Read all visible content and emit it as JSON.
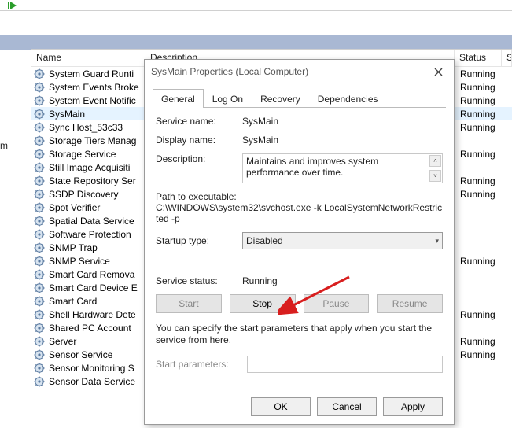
{
  "toolbar": {
    "play_icon": "play-icon"
  },
  "left_marker": "m",
  "columns": {
    "name": "Name",
    "desc": "Description",
    "status": "Status",
    "stype": "S"
  },
  "services": [
    {
      "name": "System Guard Runti",
      "status": "Running",
      "selected": false
    },
    {
      "name": "System Events Broke",
      "status": "Running",
      "selected": false
    },
    {
      "name": "System Event Notific",
      "status": "Running",
      "selected": false
    },
    {
      "name": "SysMain",
      "status": "Running",
      "selected": true
    },
    {
      "name": "Sync Host_53c33",
      "status": "Running",
      "selected": false
    },
    {
      "name": "Storage Tiers Manag",
      "status": "",
      "selected": false
    },
    {
      "name": "Storage Service",
      "status": "Running",
      "selected": false
    },
    {
      "name": "Still Image Acquisiti",
      "status": "",
      "selected": false
    },
    {
      "name": "State Repository Ser",
      "status": "Running",
      "selected": false
    },
    {
      "name": "SSDP Discovery",
      "status": "Running",
      "selected": false
    },
    {
      "name": "Spot Verifier",
      "status": "",
      "selected": false
    },
    {
      "name": "Spatial Data Service",
      "status": "",
      "selected": false
    },
    {
      "name": "Software Protection",
      "status": "",
      "selected": false
    },
    {
      "name": "SNMP Trap",
      "status": "",
      "selected": false
    },
    {
      "name": "SNMP Service",
      "status": "Running",
      "selected": false
    },
    {
      "name": "Smart Card Remova",
      "status": "",
      "selected": false
    },
    {
      "name": "Smart Card Device E",
      "status": "",
      "selected": false
    },
    {
      "name": "Smart Card",
      "status": "",
      "selected": false
    },
    {
      "name": "Shell Hardware Dete",
      "status": "Running",
      "selected": false
    },
    {
      "name": "Shared PC Account",
      "status": "",
      "selected": false
    },
    {
      "name": "Server",
      "status": "Running",
      "selected": false
    },
    {
      "name": "Sensor Service",
      "status": "Running",
      "selected": false
    },
    {
      "name": "Sensor Monitoring S",
      "status": "",
      "selected": false
    },
    {
      "name": "Sensor Data Service",
      "status": "",
      "selected": false
    }
  ],
  "dialog": {
    "title": "SysMain Properties (Local Computer)",
    "tabs": [
      "General",
      "Log On",
      "Recovery",
      "Dependencies"
    ],
    "active_tab": 0,
    "fields": {
      "service_name_label": "Service name:",
      "service_name": "SysMain",
      "display_name_label": "Display name:",
      "display_name": "SysMain",
      "description_label": "Description:",
      "description": "Maintains and improves system performance over time.",
      "path_label": "Path to executable:",
      "path": "C:\\WINDOWS\\system32\\svchost.exe -k LocalSystemNetworkRestricted -p",
      "startup_label": "Startup type:",
      "startup_value": "Disabled",
      "status_label": "Service status:",
      "status_value": "Running",
      "note": "You can specify the start parameters that apply when you start the service from here.",
      "params_label": "Start parameters:"
    },
    "buttons": {
      "start": "Start",
      "stop": "Stop",
      "pause": "Pause",
      "resume": "Resume",
      "ok": "OK",
      "cancel": "Cancel",
      "apply": "Apply"
    }
  }
}
